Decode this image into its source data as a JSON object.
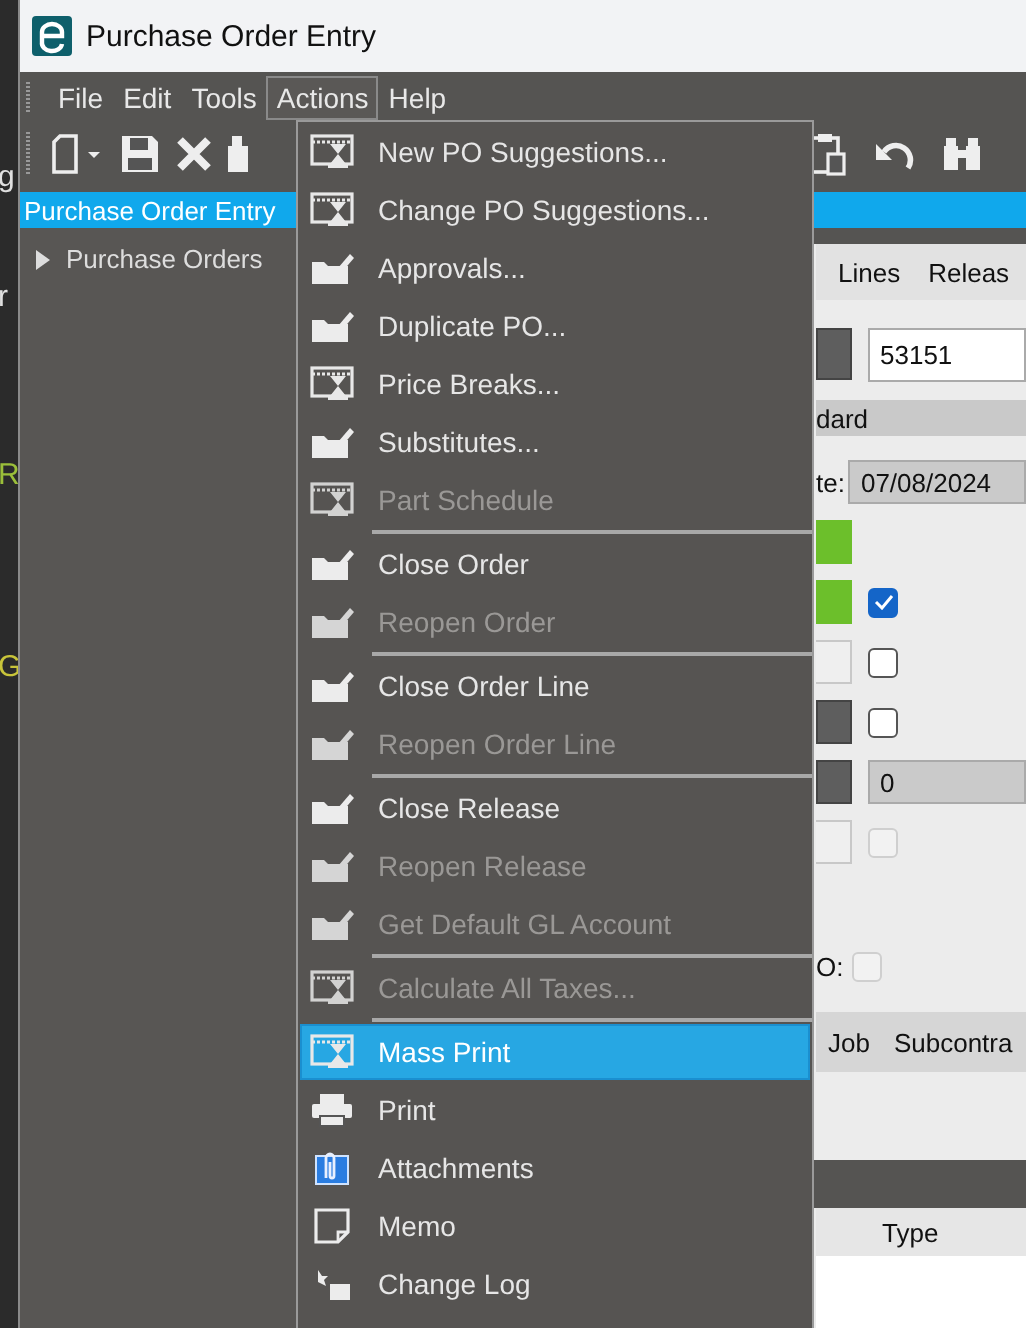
{
  "window": {
    "title": "Purchase Order Entry"
  },
  "background_window": {
    "letters": [
      {
        "text": "g",
        "color": "#e0e0e0"
      },
      {
        "text": "r",
        "color": "#e0e0e0"
      },
      {
        "text": "R",
        "color": "#9bbf3a"
      },
      {
        "text": "G",
        "color": "#c8c43a"
      }
    ]
  },
  "menu_bar": [
    {
      "label": "File",
      "selected": false
    },
    {
      "label": "Edit",
      "selected": false
    },
    {
      "label": "Tools",
      "selected": false
    },
    {
      "label": "Actions",
      "selected": true
    },
    {
      "label": "Help",
      "selected": false
    }
  ],
  "tab_bar": {
    "title": "Purchase Order Entry"
  },
  "tree": [
    {
      "label": "Purchase Orders"
    }
  ],
  "menu": {
    "items": [
      {
        "kind": "hourglass",
        "label": "New PO Suggestions...",
        "disabled": false,
        "selected": false
      },
      {
        "kind": "hourglass",
        "label": "Change PO Suggestions...",
        "disabled": false,
        "selected": false
      },
      {
        "kind": "folder",
        "label": "Approvals...",
        "disabled": false,
        "selected": false
      },
      {
        "kind": "folder",
        "label": "Duplicate PO...",
        "disabled": false,
        "selected": false
      },
      {
        "kind": "hourglass",
        "label": "Price Breaks...",
        "disabled": false,
        "selected": false
      },
      {
        "kind": "folder",
        "label": "Substitutes...",
        "disabled": false,
        "selected": false
      },
      {
        "kind": "hourglass",
        "label": "Part Schedule",
        "disabled": true,
        "selected": false
      },
      {
        "kind": "separator"
      },
      {
        "kind": "folder",
        "label": "Close Order",
        "disabled": false,
        "selected": false
      },
      {
        "kind": "folder",
        "label": "Reopen Order",
        "disabled": true,
        "selected": false
      },
      {
        "kind": "separator"
      },
      {
        "kind": "folder",
        "label": "Close Order Line",
        "disabled": false,
        "selected": false
      },
      {
        "kind": "folder",
        "label": "Reopen Order Line",
        "disabled": true,
        "selected": false
      },
      {
        "kind": "separator"
      },
      {
        "kind": "folder",
        "label": "Close Release",
        "disabled": false,
        "selected": false
      },
      {
        "kind": "folder",
        "label": "Reopen Release",
        "disabled": true,
        "selected": false
      },
      {
        "kind": "folder",
        "label": "Get Default GL Account",
        "disabled": true,
        "selected": false
      },
      {
        "kind": "separator"
      },
      {
        "kind": "hourglass",
        "label": "Calculate All Taxes...",
        "disabled": true,
        "selected": false
      },
      {
        "kind": "separator"
      },
      {
        "kind": "hourglass",
        "label": "Mass Print",
        "disabled": false,
        "selected": true
      },
      {
        "kind": "printer",
        "label": "Print",
        "disabled": false,
        "selected": false
      },
      {
        "kind": "paperclip",
        "label": "Attachments",
        "disabled": false,
        "selected": false
      },
      {
        "kind": "note",
        "label": "Memo",
        "disabled": false,
        "selected": false
      },
      {
        "kind": "log",
        "label": "Change Log",
        "disabled": false,
        "selected": false
      }
    ]
  },
  "form": {
    "tabs": [
      {
        "label": "Lines",
        "selected": false
      },
      {
        "label": "Releas",
        "selected": false
      }
    ],
    "po_number": "53151",
    "type_value": "dard",
    "date_label": "te:",
    "date_value": "07/08/2024",
    "rows": [
      {
        "kind": "green"
      },
      {
        "kind": "green_check",
        "checked": true
      },
      {
        "kind": "white_check",
        "checked": false
      },
      {
        "kind": "dark_check",
        "checked": false
      },
      {
        "kind": "dark_field",
        "value": "0"
      },
      {
        "kind": "white_check",
        "checked": false,
        "disabled": true
      }
    ],
    "o_label": "O:",
    "o_checked": false,
    "grid_tabs": [
      "Job",
      "Subcontra"
    ],
    "column_header": "Type"
  }
}
